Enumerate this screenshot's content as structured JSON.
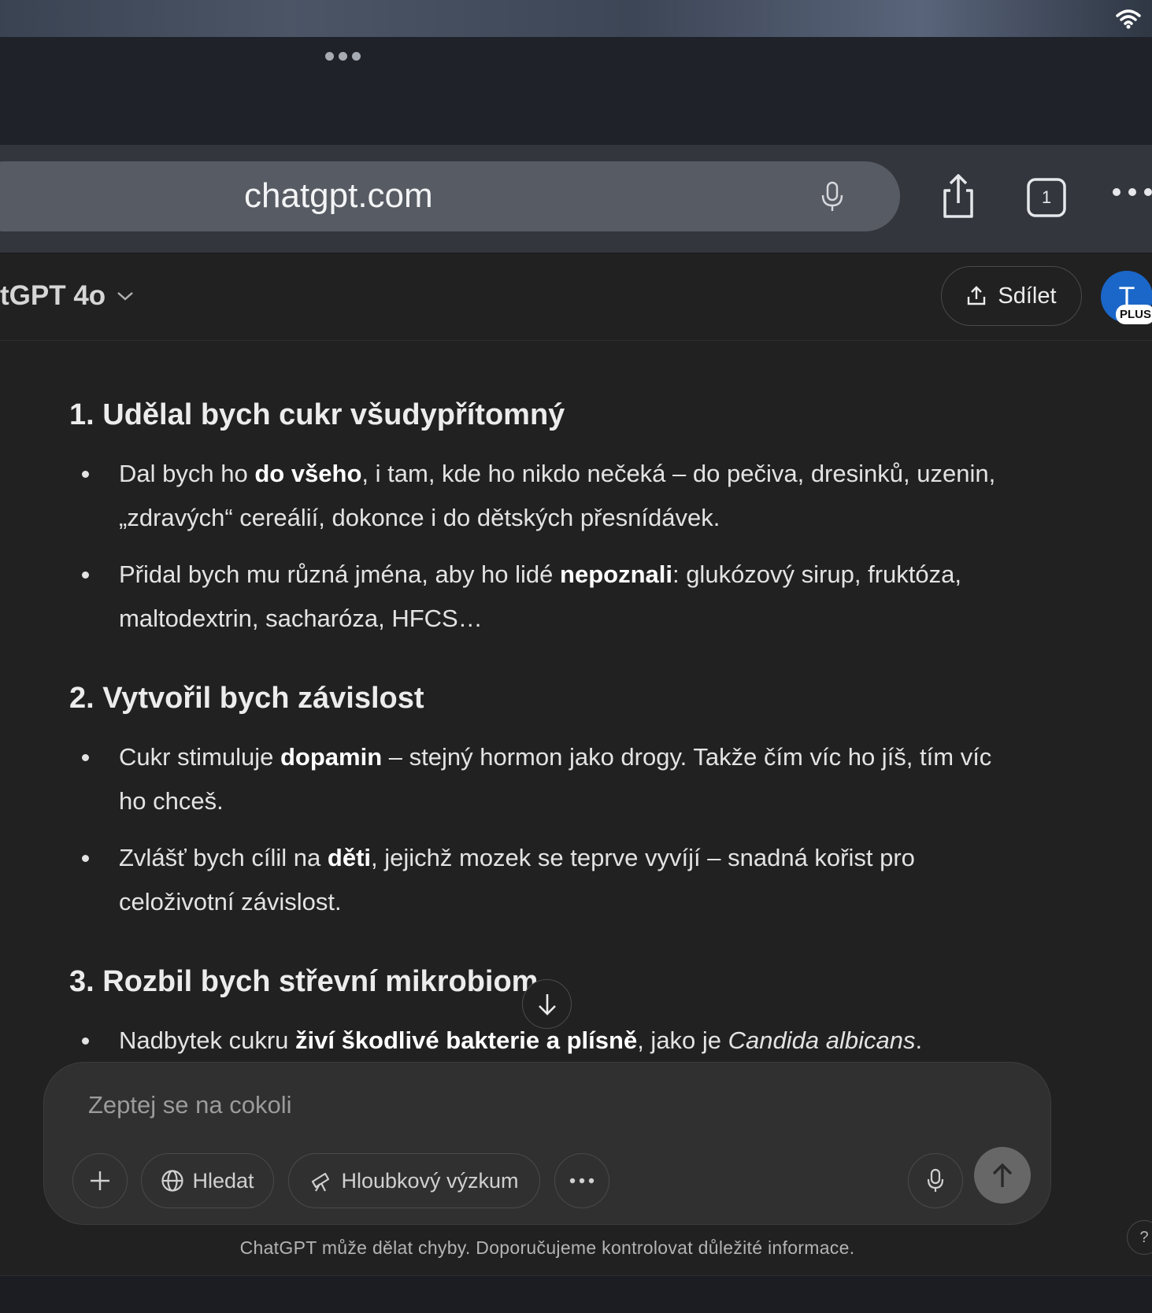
{
  "browser": {
    "url": "chatgpt.com",
    "tab_count": "1"
  },
  "header": {
    "model_name": "tGPT 4o",
    "share_label": "Sdílet",
    "avatar_initial": "T",
    "plan_badge": "PLUS"
  },
  "content": {
    "sections": [
      {
        "heading": "1. Udělal bych cukr všudypřítomný",
        "bullets": [
          {
            "before": "Dal bych ho ",
            "bold": "do všeho",
            "after": ", i tam, kde ho nikdo nečeká – do pečiva, dresinků, uzenin, „zdravých“ cereálií, dokonce i do dětských přesnídávek."
          },
          {
            "before": "Přidal bych mu různá jména, aby ho lidé ",
            "bold": "nepoznali",
            "after": ": glukózový sirup, fruktóza, maltodextrin, sacharóza, HFCS…"
          }
        ]
      },
      {
        "heading": "2. Vytvořil bych závislost",
        "bullets": [
          {
            "before": "Cukr stimuluje ",
            "bold": "dopamin",
            "after": " – stejný hormon jako drogy. Takže čím víc ho jíš, tím víc ho chceš."
          },
          {
            "before": "Zvlášť bych cílil na ",
            "bold": "děti",
            "after": ", jejichž mozek se teprve vyvíjí – snadná kořist pro celoživotní závislost."
          }
        ]
      },
      {
        "heading": "3. Rozbil bych střevní mikrobiom",
        "bullets": [
          {
            "before": "Nadbytek cukru ",
            "bold": "živí škodlivé bakterie a plísně",
            "after": ", jako je ",
            "italic": "Candida albicans",
            "end": "."
          }
        ]
      }
    ]
  },
  "composer": {
    "placeholder": "Zeptej se na cokoli",
    "search_label": "Hledat",
    "research_label": "Hloubkový výzkum"
  },
  "footer": {
    "disclaimer": "ChatGPT může dělat chyby. Doporučujeme kontrolovat důležité informace.",
    "help": "?"
  },
  "icons": {
    "wifi": "wifi-icon",
    "mic": "microphone-icon",
    "share": "share-icon",
    "tabs": "tabs-icon",
    "more": "more-icon",
    "chevron": "chevron-down-icon",
    "upload": "upload-icon",
    "arrow_down": "arrow-down-icon",
    "plus": "plus-icon",
    "globe": "globe-icon",
    "telescope": "telescope-icon",
    "arrow_up": "arrow-up-icon"
  },
  "colors": {
    "background": "#212121",
    "composer": "#303030",
    "avatar": "#1b66c9",
    "send_button": "#676767"
  }
}
